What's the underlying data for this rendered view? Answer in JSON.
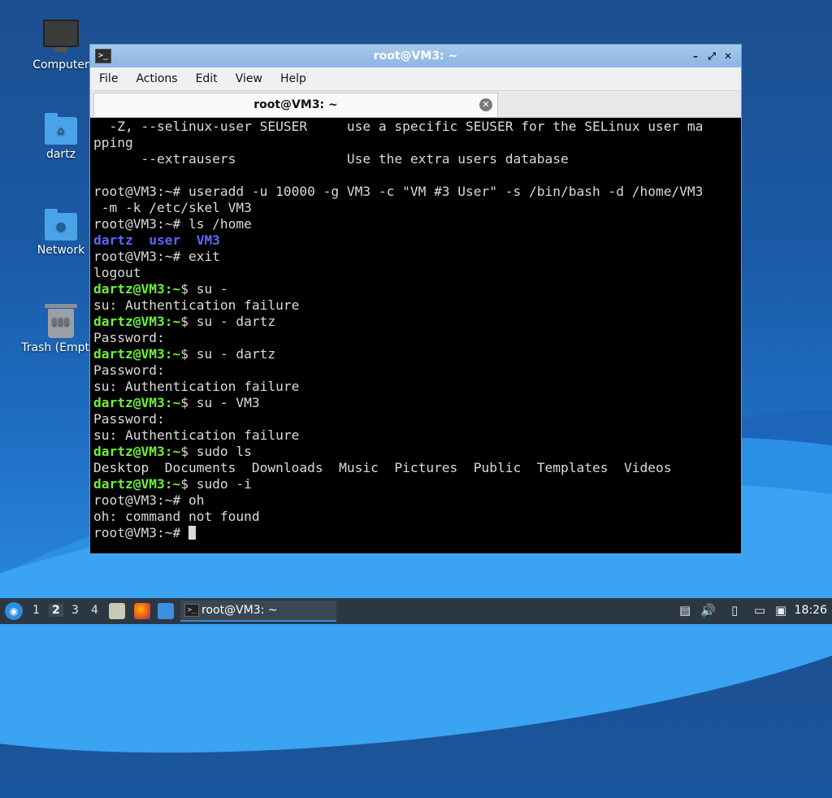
{
  "desktop": {
    "icons": [
      {
        "label": "Computer"
      },
      {
        "label": "dartz"
      },
      {
        "label": "Network"
      },
      {
        "label": "Trash (Empty)"
      }
    ]
  },
  "window": {
    "title": "root@VM3: ~",
    "app_icon_glyph": ">_",
    "controls": {
      "minimize": "–",
      "restore": "⤢",
      "close": "✕"
    },
    "menu": [
      "File",
      "Actions",
      "Edit",
      "View",
      "Help"
    ],
    "tab": {
      "label": "root@VM3: ~",
      "close_glyph": "✕"
    }
  },
  "terminal": {
    "lines": [
      [
        {
          "t": "  -Z, --selinux-user SEUSER     use a specific SEUSER for the SELinux user ma",
          "c": ""
        }
      ],
      [
        {
          "t": "pping",
          "c": ""
        }
      ],
      [
        {
          "t": "      --extrausers              Use the extra users database",
          "c": ""
        }
      ],
      [
        {
          "t": "",
          "c": ""
        }
      ],
      [
        {
          "t": "root@VM3:~# useradd -u 10000 -g VM3 -c \"VM #3 User\" -s /bin/bash -d /home/VM3",
          "c": ""
        }
      ],
      [
        {
          "t": " -m -k /etc/skel VM3",
          "c": ""
        }
      ],
      [
        {
          "t": "root@VM3:~# ls /home",
          "c": ""
        }
      ],
      [
        {
          "t": "dartz  user  VM3",
          "c": "b"
        }
      ],
      [
        {
          "t": "root@VM3:~# exit",
          "c": ""
        }
      ],
      [
        {
          "t": "logout",
          "c": ""
        }
      ],
      [
        {
          "t": "dartz@VM3:~",
          "c": "g"
        },
        {
          "t": "$ su -",
          "c": ""
        }
      ],
      [
        {
          "t": "su: Authentication failure",
          "c": ""
        }
      ],
      [
        {
          "t": "dartz@VM3:~",
          "c": "g"
        },
        {
          "t": "$ su - dartz",
          "c": ""
        }
      ],
      [
        {
          "t": "Password:",
          "c": ""
        }
      ],
      [
        {
          "t": "dartz@VM3:~",
          "c": "g"
        },
        {
          "t": "$ su - dartz",
          "c": ""
        }
      ],
      [
        {
          "t": "Password:",
          "c": ""
        }
      ],
      [
        {
          "t": "su: Authentication failure",
          "c": ""
        }
      ],
      [
        {
          "t": "dartz@VM3:~",
          "c": "g"
        },
        {
          "t": "$ su - VM3",
          "c": ""
        }
      ],
      [
        {
          "t": "Password:",
          "c": ""
        }
      ],
      [
        {
          "t": "su: Authentication failure",
          "c": ""
        }
      ],
      [
        {
          "t": "dartz@VM3:~",
          "c": "g"
        },
        {
          "t": "$ sudo ls",
          "c": ""
        }
      ],
      [
        {
          "t": "Desktop  Documents  Downloads  Music  Pictures  Public  Templates  Videos",
          "c": ""
        }
      ],
      [
        {
          "t": "dartz@VM3:~",
          "c": "g"
        },
        {
          "t": "$ sudo -i",
          "c": ""
        }
      ],
      [
        {
          "t": "root@VM3:~# oh",
          "c": ""
        }
      ],
      [
        {
          "t": "oh: command not found",
          "c": ""
        }
      ],
      [
        {
          "t": "root@VM3:~# ",
          "c": "",
          "cursor": true
        }
      ]
    ]
  },
  "taskbar": {
    "start_glyph": "◉",
    "workspaces": [
      "1",
      "2",
      "3",
      "4"
    ],
    "active_workspace": "2",
    "task": {
      "label": "root@VM3: ~",
      "icon_glyph": ">_"
    },
    "tray_icons": [
      "clipboard-icon",
      "volume-icon",
      "notes-icon",
      "network-icon",
      "update-icon"
    ],
    "clock": "18:26"
  }
}
